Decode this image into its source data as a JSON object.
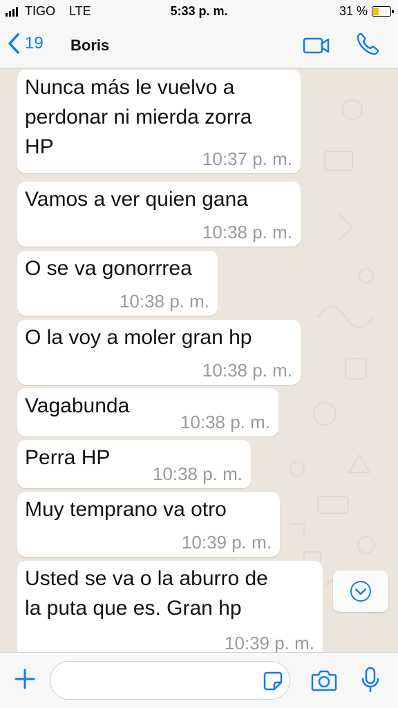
{
  "status_bar": {
    "carrier": "TIGO",
    "network": "LTE",
    "time": "5:33 p. m.",
    "battery_percent": "31 %",
    "battery_level": 0.31
  },
  "header": {
    "back_count": "19",
    "contact_name": "Boris"
  },
  "messages": [
    {
      "text": "Nunca más le vuelvo a\nperdonar ni mierda zorra\nHP",
      "time": "10:37 p. m."
    },
    {
      "text": "Vamos a ver quien gana",
      "time": "10:38 p. m."
    },
    {
      "text": "O se va gonorrrea",
      "time": "10:38 p. m."
    },
    {
      "text": "O la voy a moler gran hp",
      "time": "10:38 p. m."
    },
    {
      "text": "Vagabunda",
      "time": "10:38 p. m."
    },
    {
      "text": "Perra HP",
      "time": "10:38 p. m."
    },
    {
      "text": "Muy temprano va otro",
      "time": "10:39 p. m."
    },
    {
      "text": "Usted se va o la aburro de\nla puta que es. Gran hp",
      "time": "10:39 p. m."
    }
  ],
  "input": {
    "value": "",
    "placeholder": ""
  },
  "colors": {
    "accent": "#0f7bf2",
    "chat_background": "#ece5dd",
    "bubble": "#ffffff",
    "timestamp": "#9a9a9a",
    "battery": "#f5c400"
  },
  "icons": [
    "signal-icon",
    "battery-icon",
    "back-chevron-icon",
    "video-call-icon",
    "phone-icon",
    "scroll-down-icon",
    "plus-icon",
    "sticker-icon",
    "camera-icon",
    "microphone-icon"
  ]
}
